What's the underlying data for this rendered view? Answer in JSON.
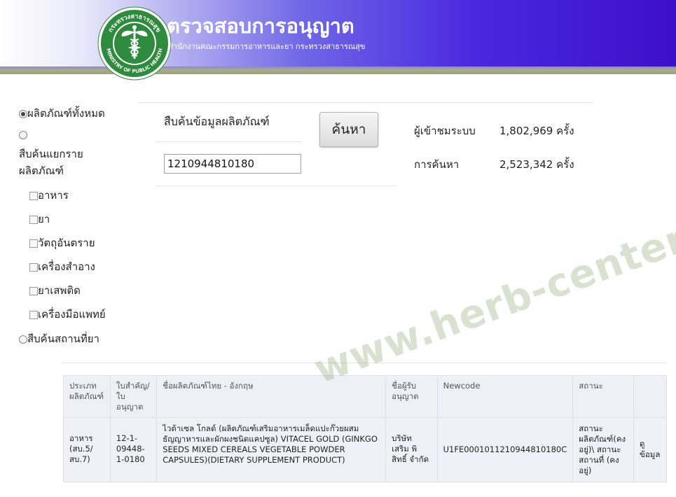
{
  "header": {
    "title": "ตรวจสอบการอนุญาต",
    "subtitle": "สำนักงานคณะกรรมการอาหารและยา กระทรวงสาธารณสุข",
    "logo_text_top": "กระทรวงสาธารณสุข",
    "logo_text_bottom": "MINISTRY OF PUBLIC HEALTH"
  },
  "sidebar": {
    "all_products": "ผลิตภัณฑ์ทั้งหมด",
    "by_type_line1": "สืบค้นแยกราย",
    "by_type_line2": "ผลิตภัณฑ์",
    "categories": [
      "อาหาร",
      "ยา",
      "วัตถุอันตราย",
      "เครื่องสำอาง",
      "ยาเสพติด",
      "เครื่องมือแพทย์"
    ],
    "pharmacy_search": "สืบค้นสถานที่ยา"
  },
  "search": {
    "heading": "สืบค้นข้อมูลผลิตภัณฑ์",
    "value": "1210944810180",
    "button": "ค้นหา"
  },
  "stats": {
    "visitors_label": "ผู้เข้าชมระบบ",
    "visitors_value": "1,802,969 ครั้ง",
    "searches_label": "การค้นหา",
    "searches_value": "2,523,342 ครั้ง"
  },
  "results": {
    "headers": [
      "ประเภทผลิตภัณฑ์",
      "ใบสำคัญ/ ใบอนุญาต",
      "ชื่อผลิตภัณฑ์ไทย - อังกฤษ",
      "ชื่อผู้รับอนุญาต",
      "Newcode",
      "สถานะ",
      ""
    ],
    "row": {
      "type": "อาหาร (สบ.5/ สบ.7)",
      "license": "12-1-09448-1-0180",
      "name": "ไวต้าเซล โกลด์ (ผลิตภัณฑ์เสริมอาหารเมล็ดแปะก๊วยผสมธัญญาหารและผักผงชนิดแคปซูล) VITACEL GOLD (GINKGO SEEDS MIXED CEREALS VEGETABLE POWDER CAPSULES)(DIETARY SUPPLEMENT PRODUCT)",
      "licensee": "บริษัท เสริม พิสิทธิ์ จำกัด",
      "newcode": "U1FE0001011210944810180C",
      "status": "สถานะผลิตภัณฑ์(คงอยู่)\\ สถานะสถานที่ (คงอยู่)",
      "action": "ดูข้อมูล"
    }
  },
  "watermark": "www.herb-center.com"
}
